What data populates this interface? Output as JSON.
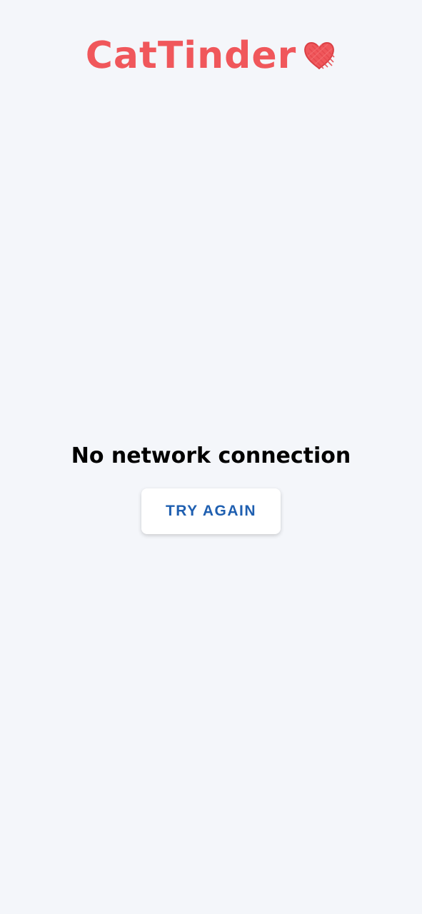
{
  "app": {
    "brand_name": "CatTinder",
    "brand_color": "#F0575B",
    "background": "#F4F6FA",
    "logo_icon": "heart-icon"
  },
  "status": {
    "message": "No network connection"
  },
  "actions": {
    "try_again_label": "TRY AGAIN",
    "button_text_color": "#1F5FB0",
    "button_background": "#FFFFFF"
  }
}
